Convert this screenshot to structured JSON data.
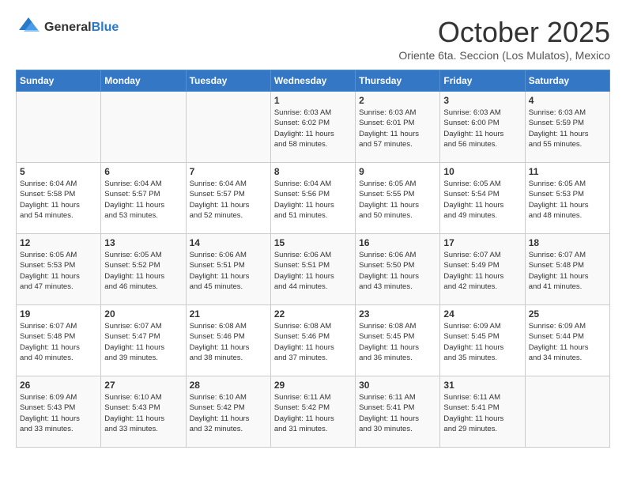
{
  "header": {
    "logo_general": "General",
    "logo_blue": "Blue",
    "title": "October 2025",
    "subtitle": "Oriente 6ta. Seccion (Los Mulatos), Mexico"
  },
  "days_of_week": [
    "Sunday",
    "Monday",
    "Tuesday",
    "Wednesday",
    "Thursday",
    "Friday",
    "Saturday"
  ],
  "weeks": [
    [
      {
        "day": "",
        "info": ""
      },
      {
        "day": "",
        "info": ""
      },
      {
        "day": "",
        "info": ""
      },
      {
        "day": "1",
        "info": "Sunrise: 6:03 AM\nSunset: 6:02 PM\nDaylight: 11 hours\nand 58 minutes."
      },
      {
        "day": "2",
        "info": "Sunrise: 6:03 AM\nSunset: 6:01 PM\nDaylight: 11 hours\nand 57 minutes."
      },
      {
        "day": "3",
        "info": "Sunrise: 6:03 AM\nSunset: 6:00 PM\nDaylight: 11 hours\nand 56 minutes."
      },
      {
        "day": "4",
        "info": "Sunrise: 6:03 AM\nSunset: 5:59 PM\nDaylight: 11 hours\nand 55 minutes."
      }
    ],
    [
      {
        "day": "5",
        "info": "Sunrise: 6:04 AM\nSunset: 5:58 PM\nDaylight: 11 hours\nand 54 minutes."
      },
      {
        "day": "6",
        "info": "Sunrise: 6:04 AM\nSunset: 5:57 PM\nDaylight: 11 hours\nand 53 minutes."
      },
      {
        "day": "7",
        "info": "Sunrise: 6:04 AM\nSunset: 5:57 PM\nDaylight: 11 hours\nand 52 minutes."
      },
      {
        "day": "8",
        "info": "Sunrise: 6:04 AM\nSunset: 5:56 PM\nDaylight: 11 hours\nand 51 minutes."
      },
      {
        "day": "9",
        "info": "Sunrise: 6:05 AM\nSunset: 5:55 PM\nDaylight: 11 hours\nand 50 minutes."
      },
      {
        "day": "10",
        "info": "Sunrise: 6:05 AM\nSunset: 5:54 PM\nDaylight: 11 hours\nand 49 minutes."
      },
      {
        "day": "11",
        "info": "Sunrise: 6:05 AM\nSunset: 5:53 PM\nDaylight: 11 hours\nand 48 minutes."
      }
    ],
    [
      {
        "day": "12",
        "info": "Sunrise: 6:05 AM\nSunset: 5:53 PM\nDaylight: 11 hours\nand 47 minutes."
      },
      {
        "day": "13",
        "info": "Sunrise: 6:05 AM\nSunset: 5:52 PM\nDaylight: 11 hours\nand 46 minutes."
      },
      {
        "day": "14",
        "info": "Sunrise: 6:06 AM\nSunset: 5:51 PM\nDaylight: 11 hours\nand 45 minutes."
      },
      {
        "day": "15",
        "info": "Sunrise: 6:06 AM\nSunset: 5:51 PM\nDaylight: 11 hours\nand 44 minutes."
      },
      {
        "day": "16",
        "info": "Sunrise: 6:06 AM\nSunset: 5:50 PM\nDaylight: 11 hours\nand 43 minutes."
      },
      {
        "day": "17",
        "info": "Sunrise: 6:07 AM\nSunset: 5:49 PM\nDaylight: 11 hours\nand 42 minutes."
      },
      {
        "day": "18",
        "info": "Sunrise: 6:07 AM\nSunset: 5:48 PM\nDaylight: 11 hours\nand 41 minutes."
      }
    ],
    [
      {
        "day": "19",
        "info": "Sunrise: 6:07 AM\nSunset: 5:48 PM\nDaylight: 11 hours\nand 40 minutes."
      },
      {
        "day": "20",
        "info": "Sunrise: 6:07 AM\nSunset: 5:47 PM\nDaylight: 11 hours\nand 39 minutes."
      },
      {
        "day": "21",
        "info": "Sunrise: 6:08 AM\nSunset: 5:46 PM\nDaylight: 11 hours\nand 38 minutes."
      },
      {
        "day": "22",
        "info": "Sunrise: 6:08 AM\nSunset: 5:46 PM\nDaylight: 11 hours\nand 37 minutes."
      },
      {
        "day": "23",
        "info": "Sunrise: 6:08 AM\nSunset: 5:45 PM\nDaylight: 11 hours\nand 36 minutes."
      },
      {
        "day": "24",
        "info": "Sunrise: 6:09 AM\nSunset: 5:45 PM\nDaylight: 11 hours\nand 35 minutes."
      },
      {
        "day": "25",
        "info": "Sunrise: 6:09 AM\nSunset: 5:44 PM\nDaylight: 11 hours\nand 34 minutes."
      }
    ],
    [
      {
        "day": "26",
        "info": "Sunrise: 6:09 AM\nSunset: 5:43 PM\nDaylight: 11 hours\nand 33 minutes."
      },
      {
        "day": "27",
        "info": "Sunrise: 6:10 AM\nSunset: 5:43 PM\nDaylight: 11 hours\nand 33 minutes."
      },
      {
        "day": "28",
        "info": "Sunrise: 6:10 AM\nSunset: 5:42 PM\nDaylight: 11 hours\nand 32 minutes."
      },
      {
        "day": "29",
        "info": "Sunrise: 6:11 AM\nSunset: 5:42 PM\nDaylight: 11 hours\nand 31 minutes."
      },
      {
        "day": "30",
        "info": "Sunrise: 6:11 AM\nSunset: 5:41 PM\nDaylight: 11 hours\nand 30 minutes."
      },
      {
        "day": "31",
        "info": "Sunrise: 6:11 AM\nSunset: 5:41 PM\nDaylight: 11 hours\nand 29 minutes."
      },
      {
        "day": "",
        "info": ""
      }
    ]
  ]
}
